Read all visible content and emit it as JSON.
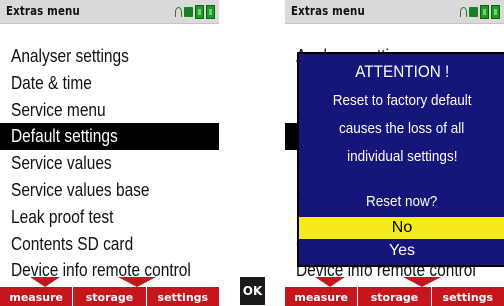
{
  "title": "Extras menu",
  "menu": {
    "items": [
      "Analyser settings",
      "Date & time",
      "Service menu",
      "Default settings",
      "Service values",
      "Service values base",
      "Leak proof test",
      "Contents SD card",
      "Device info remote control"
    ],
    "selected_index": 3
  },
  "footer": {
    "buttons": [
      "measure",
      "storage",
      "settings"
    ]
  },
  "ok_key": "OK",
  "dialog": {
    "title": "ATTENTION !",
    "lines": [
      "Reset to factory default",
      "causes the loss of all",
      "individual settings!"
    ],
    "question": "Reset now?",
    "options": [
      "No",
      "Yes"
    ],
    "selected_option": "No"
  },
  "status_icons": [
    "signal-icon",
    "sd-card-icon",
    "battery-icon",
    "battery-icon"
  ],
  "colors": {
    "titlebar": "#dadada",
    "selection": "#000000",
    "footer": "#c4161c",
    "dialog_bg": "#15157a",
    "dialog_highlight": "#f5ea1b",
    "battery": "#1f9a29"
  }
}
